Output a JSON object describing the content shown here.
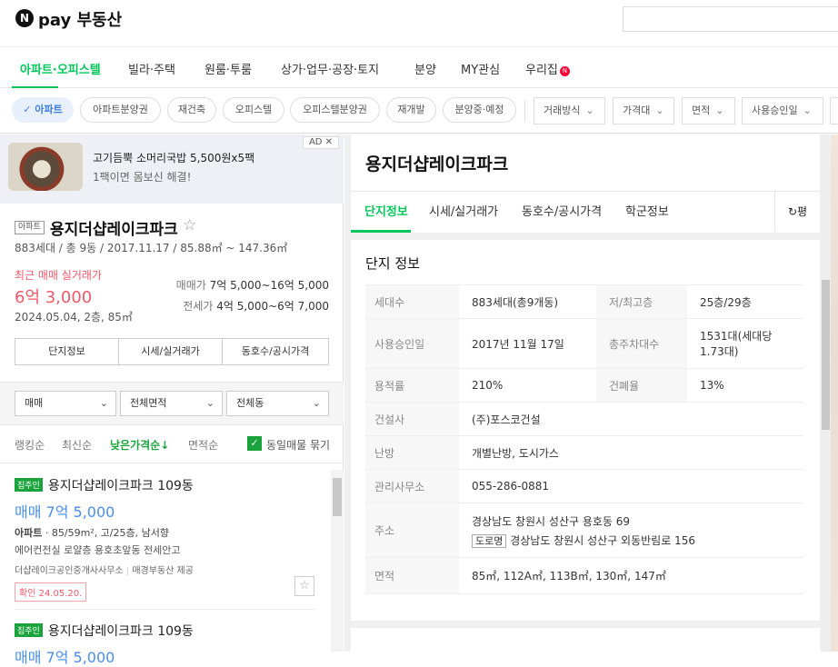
{
  "header": {
    "logo_letter": "N",
    "logo": "pay 부동산"
  },
  "nav": {
    "items": [
      "아파트·오피스텔",
      "빌라·주택",
      "원룸·투룸",
      "상가·업무·공장·토지",
      "분양",
      "MY관심",
      "우리집"
    ],
    "badge": "N"
  },
  "filters": {
    "chips": [
      "✓ 아파트",
      "아파트분양권",
      "재건축",
      "오피스텔",
      "오피스텔분양권",
      "재개발",
      "분양중·예정"
    ],
    "dropdowns": [
      "거래방식",
      "가격대",
      "면적",
      "사용승인일"
    ]
  },
  "ad": {
    "label": "AD",
    "close": "✕",
    "title": "고기듬뿍 소머리국밥 5,500원x5팩",
    "subtitle": "1팩이면 몸보신 해결!"
  },
  "summary": {
    "type_tag": "아파트",
    "name": "용지더샵레이크파크",
    "star": "☆",
    "meta": "883세대 / 총 9동 / 2017.11.17 / 85.88㎡ ~ 147.36㎡",
    "recent_label": "최근 매매 실거래가",
    "recent_price": "6억 3,000",
    "recent_detail": "2024.05.04, 2층, 85㎡",
    "sale_label": "매매가",
    "sale_range": "7억 5,000~16억 5,000",
    "jeonse_label": "전세가",
    "jeonse_range": "4억 5,000~6억 7,000",
    "buttons": [
      "단지정보",
      "시세/실거래가",
      "동호수/공시가격"
    ]
  },
  "list_filters": {
    "selects": [
      "매매",
      "전체면적",
      "전체동"
    ],
    "sorts": [
      "랭킹순",
      "최신순",
      "낮은가격순↓",
      "면적순"
    ],
    "group_label": "동일매물 묶기"
  },
  "listings": [
    {
      "tag": "집주인",
      "title": "용지더샵레이크파크 109동",
      "price": "매매 7억 5,000",
      "spec_type": "아파트",
      "spec": " · 85/59m², 고/25층, 남서향",
      "desc": "에어컨전실 로얄층 용호초앞동 전세안고",
      "agent": "더샵레이크공인중개사사무소",
      "provider": "매경부동산 제공",
      "confirm": "확인 24.05.20."
    },
    {
      "tag": "집주인",
      "title": "용지더샵레이크파크 109동",
      "price": "매매 7억 5,000"
    }
  ],
  "detail": {
    "title": "용지더샵레이크파크",
    "tabs": [
      "단지정보",
      "시세/실거래가",
      "동호수/공시가격",
      "학군정보"
    ],
    "unit_toggle": "평",
    "section": "단지 정보",
    "rows": {
      "households_l": "세대수",
      "households": "883세대(총9개동)",
      "floors_l": "저/최고층",
      "floors": "25층/29층",
      "approval_l": "사용승인일",
      "approval": "2017년 11월 17일",
      "parking_l": "총주차대수",
      "parking": "1531대(세대당 1.73대)",
      "far_l": "용적률",
      "far": "210%",
      "bcr_l": "건폐율",
      "bcr": "13%",
      "builder_l": "건설사",
      "builder": "(주)포스코건설",
      "heating_l": "난방",
      "heating": "개별난방, 도시가스",
      "office_l": "관리사무소",
      "office": "055-286-0881",
      "addr_l": "주소",
      "addr": "경상남도 창원시 성산구 용호동 69",
      "road_tag": "도로명",
      "road": "경상남도 창원시 성산구 외동반림로 156",
      "area_l": "면적",
      "area": "85㎡, 112A㎡, 113B㎡, 130㎡, 147㎡"
    }
  }
}
